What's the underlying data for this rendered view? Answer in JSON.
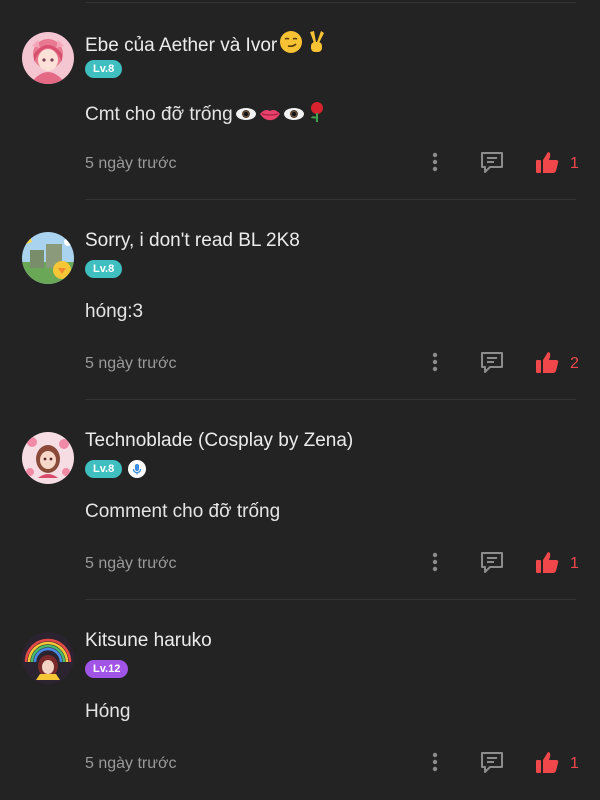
{
  "colors": {
    "background": "#232323",
    "divider": "#343434",
    "like_accent": "#f0484a",
    "timestamp": "#9a9a9a"
  },
  "comments": [
    {
      "username": "Ebe của Aether và Ivor",
      "username_emoji": "smirk-face, victory-hand",
      "level": "Lv.8",
      "level_color": "#3fbfbf",
      "content": "Cmt cho đỡ trống",
      "content_emoji": "eye, lips, eye, rose",
      "timestamp": "5 ngày trước",
      "likes": "1",
      "icons": {
        "more": "more-vertical-icon",
        "reply": "reply-bubble-icon",
        "like": "thumbs-up-icon"
      }
    },
    {
      "username": "Sorry, i don't read BL 2K8",
      "level": "Lv.8",
      "level_color": "#3fbfbf",
      "content": "hóng:3",
      "timestamp": "5 ngày trước",
      "likes": "2",
      "icons": {
        "more": "more-vertical-icon",
        "reply": "reply-bubble-icon",
        "like": "thumbs-up-icon"
      }
    },
    {
      "username": "Technoblade (Cosplay by Zena)",
      "level": "Lv.8",
      "level_color": "#3fbfbf",
      "extra_badge": "microphone-icon",
      "content": "Comment cho đỡ trống",
      "timestamp": "5 ngày trước",
      "likes": "1",
      "icons": {
        "more": "more-vertical-icon",
        "reply": "reply-bubble-icon",
        "like": "thumbs-up-icon"
      }
    },
    {
      "username": "Kitsune haruko",
      "level": "Lv.12",
      "level_color": "#a155e6",
      "content": "Hóng",
      "timestamp": "5 ngày trước",
      "likes": "1",
      "icons": {
        "more": "more-vertical-icon",
        "reply": "reply-bubble-icon",
        "like": "thumbs-up-icon"
      }
    }
  ]
}
